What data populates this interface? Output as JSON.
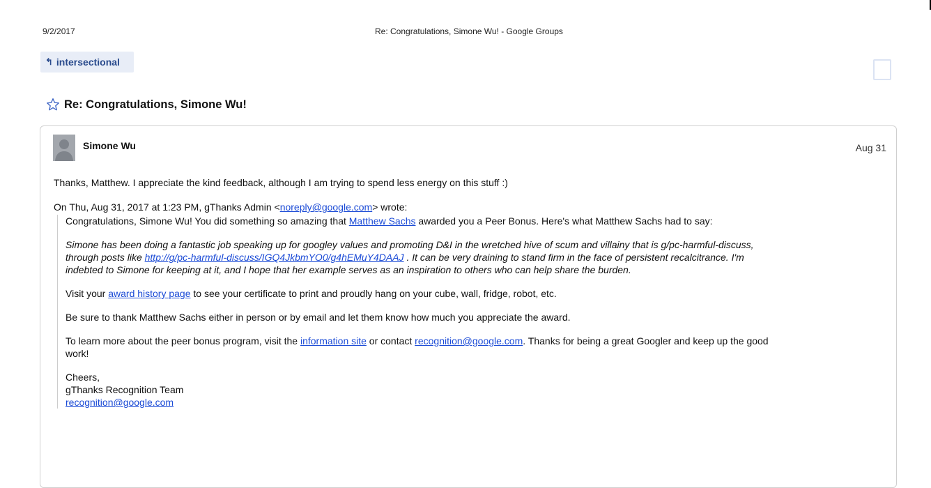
{
  "print_header": {
    "date": "9/2/2017",
    "title": "Re: Congratulations, Simone Wu! - Google Groups"
  },
  "group": {
    "name": "intersectional"
  },
  "subject": "Re: Congratulations, Simone Wu!",
  "message": {
    "sender": "Simone Wu",
    "date": "Aug 31",
    "reply_text": "Thanks, Matthew. I appreciate the kind feedback, although I am trying to spend less energy on this stuff :)",
    "quote_intro_prefix": "On Thu, Aug 31, 2017 at 1:23 PM, gThanks Admin <",
    "quote_intro_email": "noreply@google.com",
    "quote_intro_suffix": "> wrote:",
    "quoted": {
      "p1_prefix": "Congratulations, Simone Wu! You did something so amazing that ",
      "p1_link": "Matthew Sachs",
      "p1_suffix": " awarded you a Peer Bonus. Here's what Matthew Sachs had to say:",
      "p2_line1": "Simone has been doing a fantastic job speaking up for googley values and promoting D&I in the wretched hive of scum and villainy that is g/pc-harmful-discuss,",
      "p2_line2_prefix": "through posts like ",
      "p2_line2_link": "http://g/pc-harmful-discuss/IGQ4JkbmYO0/g4hEMuY4DAAJ",
      "p2_line2_suffix": " . It can be very draining to stand firm in the face of persistent recalcitrance. I'm",
      "p2_line3": "indebted to Simone for keeping at it, and I hope that her example serves as an inspiration to others who can help share the burden.",
      "p3_prefix": "Visit your ",
      "p3_link": "award history page",
      "p3_suffix": " to see your certificate to print and proudly hang on your cube, wall, fridge, robot, etc.",
      "p4": "Be sure to thank Matthew Sachs either in person or by email and let them know how much you appreciate the award.",
      "p5_prefix": "To learn more about the peer bonus program, visit the ",
      "p5_link1": "information site",
      "p5_mid": " or contact ",
      "p5_link2": "recognition@google.com",
      "p5_suffix": ". Thanks for being a great Googler and keep up the good",
      "p5_line2": "work!",
      "sig_line1": "Cheers,",
      "sig_line2": "gThanks Recognition Team",
      "sig_email": "recognition@google.com"
    }
  },
  "colors": {
    "link": "#1a4ad6",
    "group_tag_bg": "#e8edf7",
    "group_tag_text": "#2a4b8d"
  },
  "icons": {
    "group_tag": "up-arrow-icon",
    "subject": "star-icon",
    "avatar": "person-silhouette-icon",
    "corner": "checkbox-icon"
  }
}
